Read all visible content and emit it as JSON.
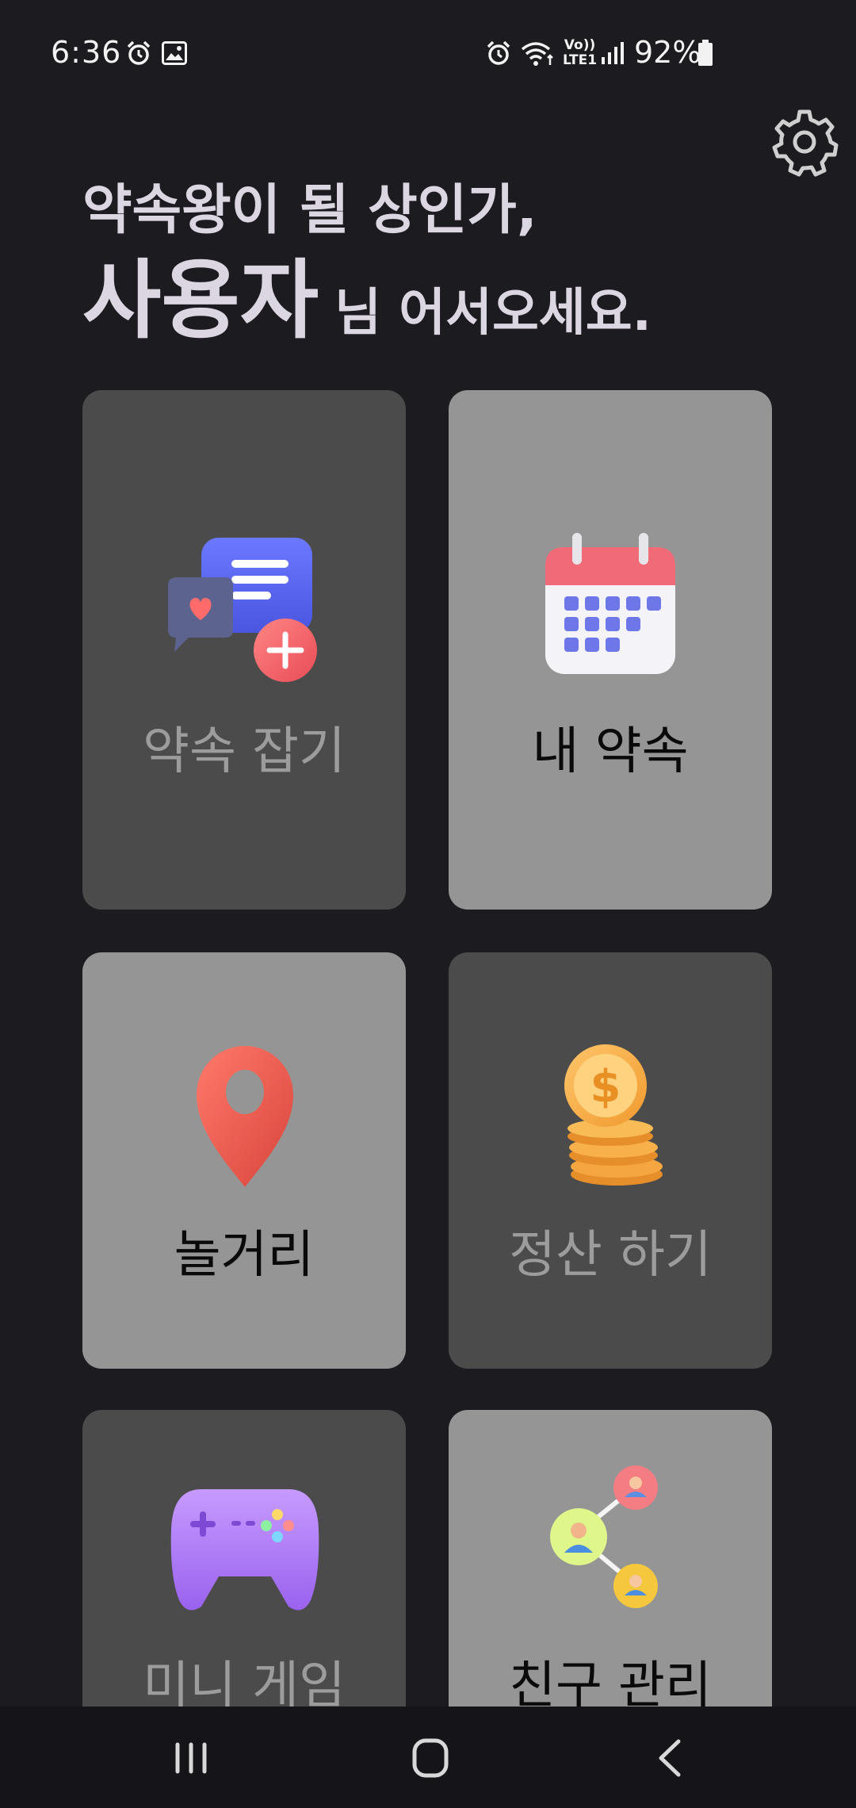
{
  "status_bar": {
    "time": "6:36",
    "battery_percent": "92%",
    "network_label_top": "Vo))",
    "network_label_bottom": "LTE1",
    "icons": [
      "alarm-icon",
      "gallery-icon",
      "alarm-icon",
      "wifi-icon",
      "signal-icon",
      "battery-icon"
    ]
  },
  "header": {
    "settings_icon": "gear-icon"
  },
  "greeting": {
    "line1": "약속왕이 될 상인가,",
    "name": "사용자",
    "suffix": "님 어서오세요."
  },
  "menu": {
    "items": [
      {
        "label": "약속 잡기",
        "icon": "chat-plus-icon",
        "style": "dark"
      },
      {
        "label": "내 약속",
        "icon": "calendar-icon",
        "style": "light"
      },
      {
        "label": "놀거리",
        "icon": "location-pin-icon",
        "style": "light"
      },
      {
        "label": "정산 하기",
        "icon": "coins-icon",
        "style": "dark"
      },
      {
        "label": "미니 게임",
        "icon": "gamepad-icon",
        "style": "dark"
      },
      {
        "label": "친구 관리",
        "icon": "friends-network-icon",
        "style": "light"
      }
    ]
  },
  "nav_bar": {
    "buttons": [
      "recent-apps-icon",
      "home-icon",
      "back-icon"
    ]
  },
  "colors": {
    "background": "#1c1b1f",
    "card_dark": "#4b4b4b",
    "card_light": "#959595",
    "greeting_text": "#dcd6e2"
  }
}
